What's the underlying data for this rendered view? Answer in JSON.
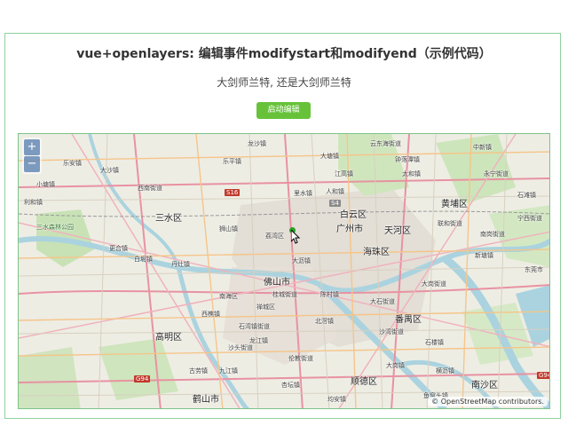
{
  "header": {
    "title": "vue+openlayers: 编辑事件modifystart和modifyend（示例代码）",
    "subtitle": "大剑师兰特, 还是大剑师兰特",
    "button_label": "启动编辑"
  },
  "map": {
    "zoom_in": "+",
    "zoom_out": "−",
    "attribution": "© OpenStreetMap contributors.",
    "labels": {
      "l1": "龙沙镇",
      "l2": "乐平镇",
      "l3": "大沙镇",
      "l4": "云东海街道",
      "l5": "乐安镇",
      "l6": "大塘镇",
      "l7": "小塘镇",
      "l8": "三水区",
      "l9": "西南街道",
      "l10": "利和镇",
      "l11": "更合镇",
      "l12": "白坭镇",
      "l13": "丹灶镇",
      "l14": "狮山镇",
      "l15": "佛山市",
      "l16": "禅城区",
      "l17": "南海区",
      "l18": "高明区",
      "l19": "鹤山市",
      "l20": "九江镇",
      "l21": "龙江镇",
      "l22": "古劳镇",
      "l23": "顺德区",
      "l24": "番禺区",
      "l25": "广州市",
      "l26": "天河区",
      "l27": "海珠区",
      "l28": "白云区",
      "l29": "黄埔区",
      "l30": "荔湾区",
      "l31": "南沙区",
      "l32": "大石街道",
      "l33": "石楼镇",
      "l34": "新塘镇",
      "l35": "中新镇",
      "l36": "人和镇",
      "l37": "太和镇",
      "l38": "大岗镇",
      "l39": "横沥镇",
      "l40": "沙湾街道",
      "l41": "陈村镇",
      "l42": "北滘镇",
      "l43": "伦教街道",
      "l44": "杏坛镇",
      "l45": "均安镇",
      "l46": "西樵镇",
      "l47": "桂城街道",
      "l48": "里水镇",
      "l49": "大沥镇",
      "l50": "石湾镇街道",
      "l51": "沙头街道",
      "l52": "江高镇",
      "l53": "钟落潭镇",
      "l54": "石滩镇",
      "l55": "永宁街道",
      "l56": "宁西街道",
      "l57": "南岗街道",
      "l58": "联和街道",
      "l59": "东莞市",
      "l60": "三水森林公园",
      "l61": "大岗街道",
      "l62": "鱼窝头镇"
    },
    "shields": {
      "s1": "S16",
      "s2": "G94",
      "s3": "G94",
      "s4": "S4"
    }
  }
}
